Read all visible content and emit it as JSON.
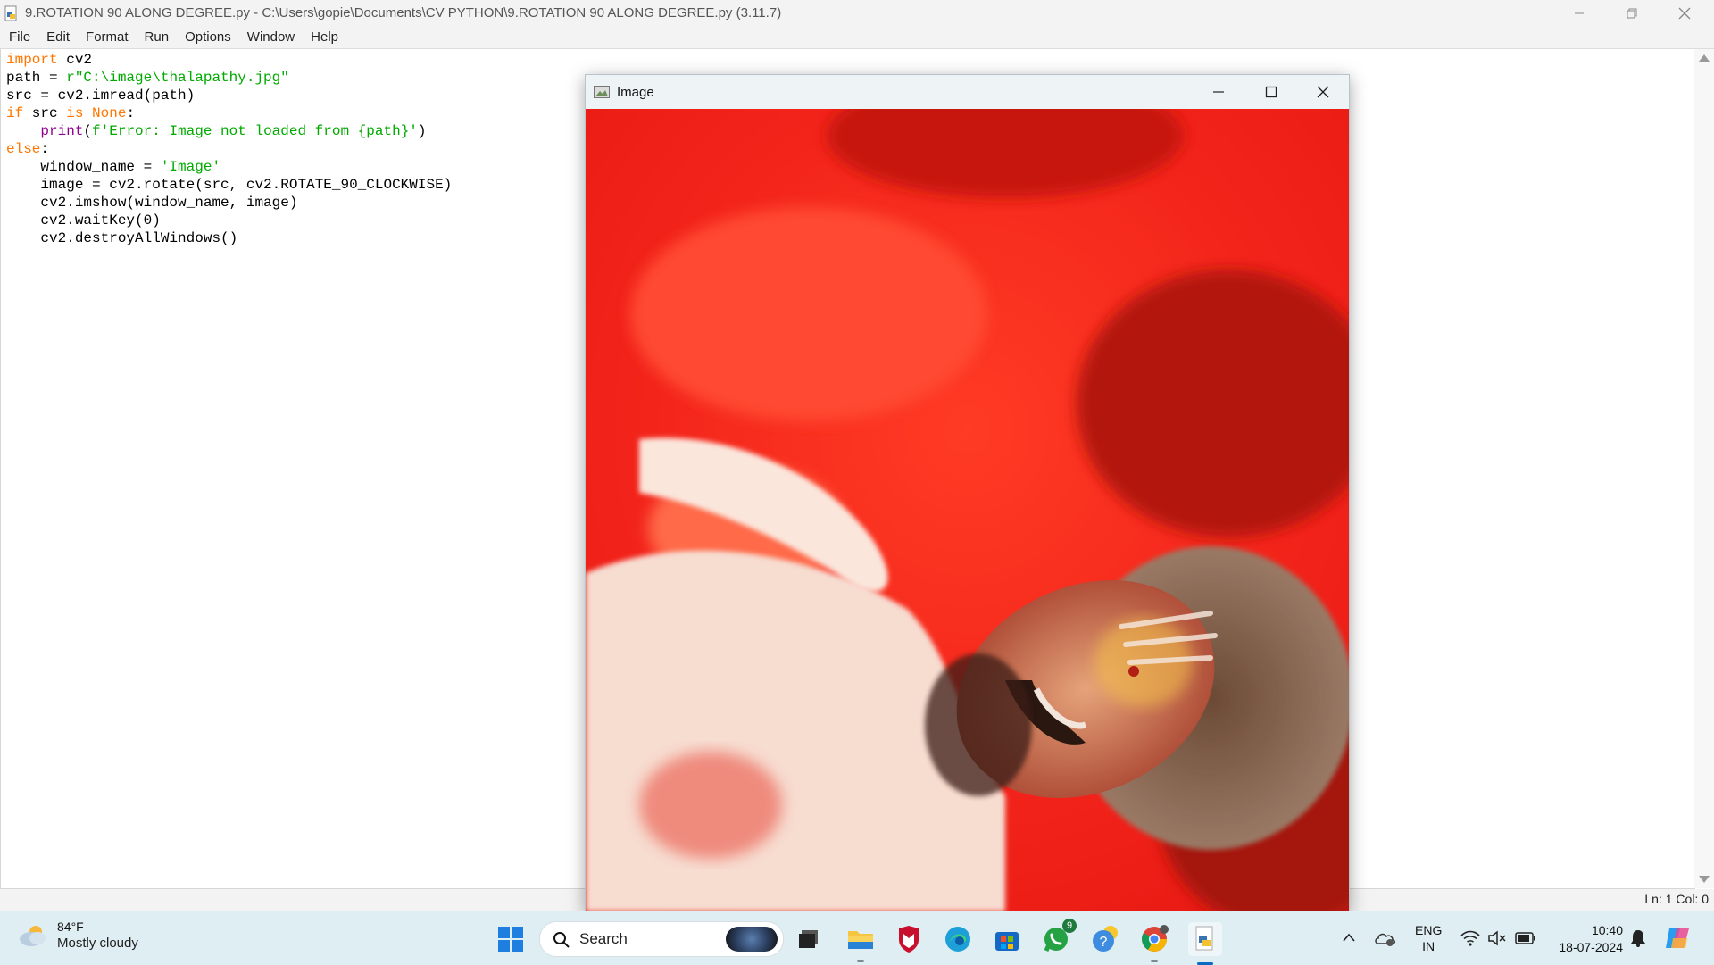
{
  "idle": {
    "title": "9.ROTATION 90 ALONG DEGREE.py - C:\\Users\\gopie\\Documents\\CV PYTHON\\9.ROTATION 90 ALONG DEGREE.py (3.11.7)",
    "menu": [
      "File",
      "Edit",
      "Format",
      "Run",
      "Options",
      "Window",
      "Help"
    ],
    "code": {
      "l1_kw": "import",
      "l1_rest": " cv2",
      "l2_a": "path = ",
      "l2_str": "r\"C:\\image\\thalapathy.jpg\"",
      "l3": "src = cv2.imread(path)",
      "l4_if": "if",
      "l4_mid": " src ",
      "l4_is": "is",
      "l4_none": " None",
      "l4_colon": ":",
      "l5_indent": "    ",
      "l5_print": "print",
      "l5_open": "(",
      "l5_str": "f'Error: Image not loaded from {path}'",
      "l5_close": ")",
      "l6_else": "else",
      "l6_colon": ":",
      "l7_a": "    window_name = ",
      "l7_str": "'Image'",
      "l8": "    image = cv2.rotate(src, cv2.ROTATE_90_CLOCKWISE)",
      "l9": "    cv2.imshow(window_name, image)",
      "l10": "    cv2.waitKey(0)",
      "l11": "    cv2.destroyAllWindows()"
    },
    "status": "Ln: 1   Col: 0"
  },
  "image_window": {
    "title": "Image"
  },
  "taskbar": {
    "weather_temp": "84°F",
    "weather_cond": "Mostly cloudy",
    "search_label": "Search",
    "whatsapp_badge": "9",
    "lang_top": "ENG",
    "lang_bottom": "IN",
    "time": "10:40",
    "date": "18-07-2024"
  }
}
